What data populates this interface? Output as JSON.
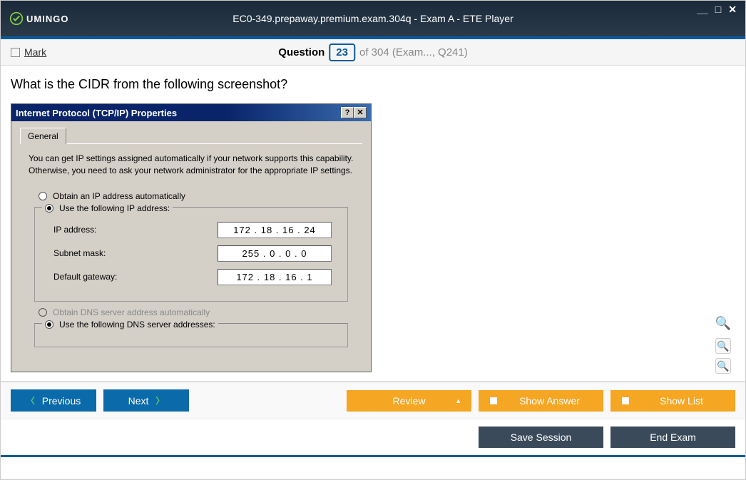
{
  "window": {
    "logo_text": "UMINGO",
    "title": "EC0-349.prepaway.premium.exam.304q - Exam A - ETE Player"
  },
  "question_bar": {
    "mark_label": "Mark",
    "question_label": "Question",
    "current": "23",
    "total_text": "of 304 (Exam..., Q241)"
  },
  "question": {
    "text": "What is the CIDR from the following screenshot?"
  },
  "dialog": {
    "title": "Internet Protocol (TCP/IP) Properties",
    "tab": "General",
    "info": "You can get IP settings assigned automatically if your network supports this capability. Otherwise, you need to ask your network administrator for the appropriate IP settings.",
    "radio_obtain_ip": "Obtain an IP address automatically",
    "radio_use_ip": "Use the following IP address:",
    "ip_label": "IP address:",
    "ip_value": "172 . 18 . 16 . 24",
    "subnet_label": "Subnet mask:",
    "subnet_value": "255 .  0  .  0  .  0",
    "gateway_label": "Default gateway:",
    "gateway_value": "172 . 18 . 16 .  1",
    "radio_obtain_dns": "Obtain DNS server address automatically",
    "radio_use_dns": "Use the following DNS server addresses:"
  },
  "nav": {
    "previous": "Previous",
    "next": "Next",
    "review": "Review",
    "show_answer": "Show Answer",
    "show_list": "Show List",
    "save_session": "Save Session",
    "end_exam": "End Exam"
  }
}
